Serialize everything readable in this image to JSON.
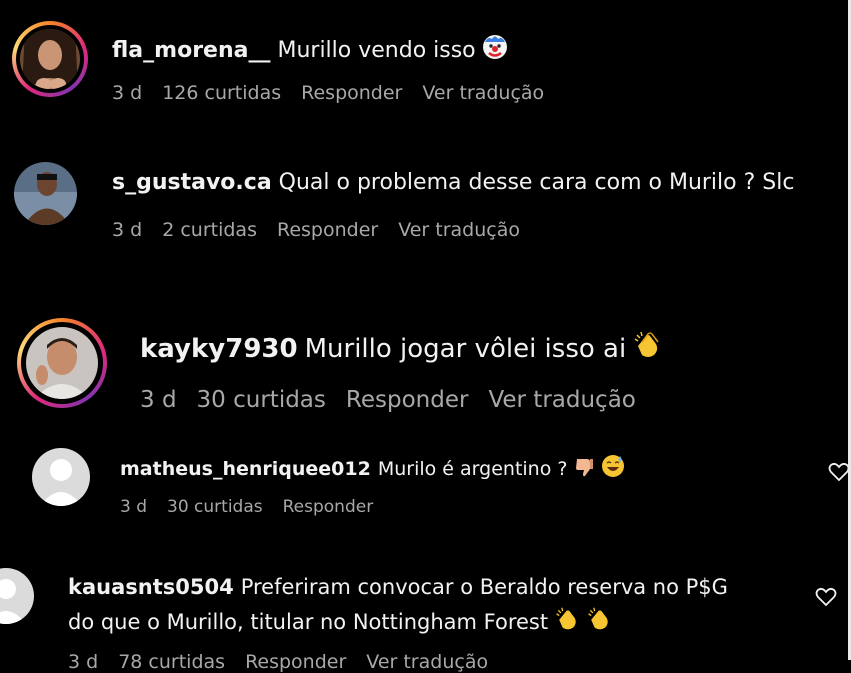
{
  "comments": [
    {
      "username": "fla_morena__",
      "text": "Murillo vendo isso",
      "emoji": "clown-face-icon",
      "age": "3 d",
      "likes": "126 curtidas",
      "reply": "Responder",
      "translate": "Ver tradução"
    },
    {
      "username": "s_gustavo.ca",
      "text": "Qual o problema desse cara com o Murilo ? Slc",
      "age": "3 d",
      "likes": "2 curtidas",
      "reply": "Responder",
      "translate": "Ver tradução"
    },
    {
      "username": "kayky7930",
      "text": "Murillo jogar vôlei isso ai",
      "emoji": "clapping-hands-icon",
      "age": "3 d",
      "likes": "30 curtidas",
      "reply": "Responder",
      "translate": "Ver tradução"
    },
    {
      "username": "matheus_henriquee012",
      "text": "Murilo é argentino ?",
      "emoji": "thumbs-down-icon, grinning-sweat-icon",
      "age": "3 d",
      "likes": "30 curtidas",
      "reply": "Responder"
    },
    {
      "username": "kauasnts0504",
      "text_line1": "Preferiram convocar o Beraldo reserva no P$G",
      "text_line2": "do que o Murillo, titular no Nottingham Forest",
      "emoji": "clapping-hands-icon",
      "age": "3 d",
      "likes": "78 curtidas",
      "reply": "Responder",
      "translate": "Ver tradução"
    }
  ],
  "colors": {
    "background": "#000000",
    "text": "#f2f2f2",
    "meta": "#a8a8a8",
    "story_ring": "#dd2a7b"
  }
}
